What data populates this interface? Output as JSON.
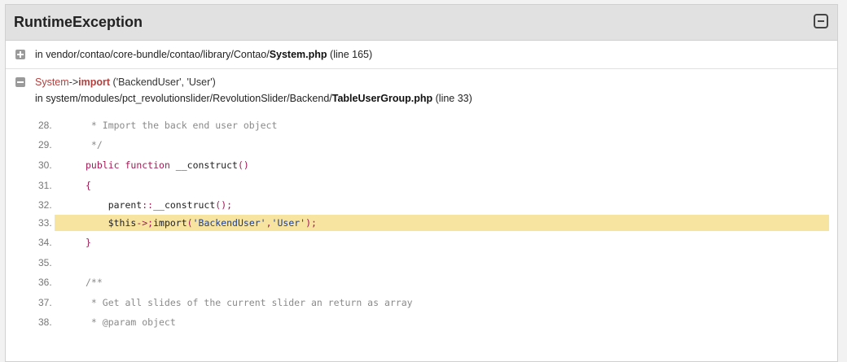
{
  "exception": {
    "title": "RuntimeException"
  },
  "frame1": {
    "prefix": "in vendor/contao/core-bundle/contao/library/Contao/",
    "file": "System.php",
    "line": "(line 165)"
  },
  "frame2": {
    "class": "System",
    "arrow": "->",
    "method": "import",
    "args": "('BackendUser', 'User')",
    "prefix": "in system/modules/pct_revolutionslider/RevolutionSlider/Backend/",
    "file": "TableUserGroup.php",
    "line": "(line 33)"
  },
  "code": {
    "highlight_line": "33.",
    "lines": [
      {
        "num": "28.",
        "text": " * Import the back end user object"
      },
      {
        "num": "29.",
        "text": " */"
      },
      {
        "num": "30.",
        "text": "public function __construct()"
      },
      {
        "num": "31.",
        "text": "{"
      },
      {
        "num": "32.",
        "text": "    parent::__construct();"
      },
      {
        "num": "33.",
        "text": "    $this->import('BackendUser','User');"
      },
      {
        "num": "34.",
        "text": "}"
      },
      {
        "num": "35.",
        "text": ""
      },
      {
        "num": "36.",
        "text": "/**"
      },
      {
        "num": "37.",
        "text": " * Get all slides of the current slider an return as array"
      },
      {
        "num": "38.",
        "text": " * @param object"
      }
    ]
  },
  "colors": {
    "highlight": "#f7e4a1",
    "keyword": "#a11a56",
    "string": "#1d3f91",
    "trace_method": "#b0413e"
  },
  "icons": {
    "collapse": "minus-square-icon",
    "expand_frame": "plus-box-icon",
    "collapse_frame": "minus-box-icon"
  }
}
